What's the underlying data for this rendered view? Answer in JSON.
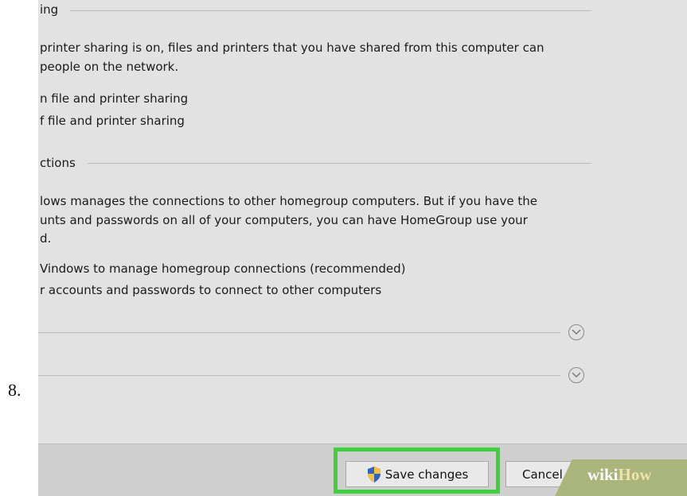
{
  "step": {
    "number": "8."
  },
  "sections": {
    "sharing_header": "ing",
    "sharing_desc_1": "printer sharing is on, files and printers that you have shared from this computer can",
    "sharing_desc_2": "people on the network.",
    "option_on": "n file and printer sharing",
    "option_off": "f file and printer sharing",
    "connections_header": "ctions",
    "conn_desc_1": "lows manages the connections to other homegroup computers. But if you have the",
    "conn_desc_2": "unts and passwords on all of your computers, you can have HomeGroup use your",
    "conn_desc_3": "d.",
    "option_windows": "Vindows to manage homegroup connections (recommended)",
    "option_accounts": "r accounts and passwords to connect to other computers"
  },
  "icons": {
    "expand_1": "chevron-down-icon",
    "expand_2": "chevron-down-icon",
    "shield": "uac-shield-icon"
  },
  "buttons": {
    "save_label": "Save changes",
    "cancel_label": "Cancel"
  },
  "watermark": {
    "part1": "wiki",
    "part2": "How"
  },
  "colors": {
    "highlight": "#3ed23a",
    "panel": "#e2e2e2"
  }
}
